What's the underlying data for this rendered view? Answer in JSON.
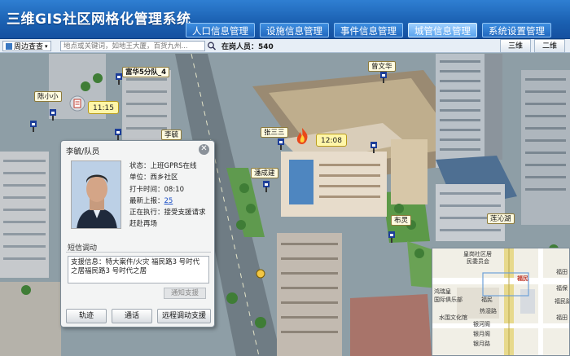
{
  "header": {
    "app_title": "三维GIS社区网格化管理系统",
    "tabs": [
      {
        "label": "人口信息管理"
      },
      {
        "label": "设施信息管理"
      },
      {
        "label": "事件信息管理"
      },
      {
        "label": "城管信息管理"
      },
      {
        "label": "系统设置管理"
      }
    ],
    "active_tab": "城管信息管理"
  },
  "toolbar": {
    "nearby_label": "周边查查",
    "search_placeholder": "地点或关键词，如地王大厦，百货九州...",
    "online_label": "在岗人员：540",
    "view_3d": "三维",
    "view_2d": "二维"
  },
  "map": {
    "labels": {
      "unit_name": "富华5分队_4",
      "person_1": "陈小小",
      "time_1": "11:15",
      "person_2": "李毓",
      "person_3": "张三三",
      "time_2": "12:08",
      "person_4": "曾文华",
      "person_5": "潘成建",
      "person_6": "布灵",
      "place": "莲沁湖"
    }
  },
  "popup": {
    "title": "李毓/队员",
    "close": "✕",
    "status": "状态：上班GPRS在线",
    "unit": "单位：西乡社区",
    "clock_in": "打卡时间：08:10",
    "latest_report_label": "最新上报：",
    "latest_report_count": "25",
    "executing": "正在执行：接受支援请求",
    "executing_2": "赶赴再场",
    "section_title": "短信调动",
    "dispatch_text": "支援信息：特大案件/火灾    福民路3 号时代之居福民路3 号时代之居",
    "notify_button": "通知支援",
    "buttons": [
      {
        "label": "轨迹"
      },
      {
        "label": "通话"
      },
      {
        "label": "远程调动支援"
      }
    ]
  },
  "minimap": {
    "labels": {
      "a": "皇岗社区居",
      "b": "民委员会",
      "c": "福民",
      "d": "福田",
      "e": "福保",
      "f": "鸿瑞皇",
      "g": "国际俱乐部",
      "h": "福民",
      "i": "热湿路",
      "j": "福民路",
      "k": "水围文化馆",
      "l": "福田",
      "m": "银河阁",
      "n": "银月阁",
      "o": "银月路"
    }
  },
  "colors": {
    "header": "#1a5fb0",
    "accent": "#5aa3ee",
    "time_tag": "#fff6a8"
  }
}
